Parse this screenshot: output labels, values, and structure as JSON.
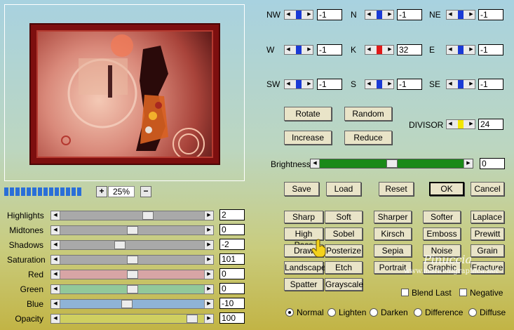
{
  "zoom": {
    "minus": "−",
    "plus": "+",
    "value": "25%"
  },
  "progress_segments": 14,
  "sliders": [
    {
      "label": "Highlights",
      "value": "2",
      "pos": 0.62,
      "color": "#a9a9a9"
    },
    {
      "label": "Midtones",
      "value": "0",
      "pos": 0.5,
      "color": "#a9a9a9"
    },
    {
      "label": "Shadows",
      "value": "-2",
      "pos": 0.41,
      "color": "#a9a9a9"
    },
    {
      "label": "Saturation",
      "value": "101",
      "pos": 0.5,
      "color": "#a9a9a9"
    },
    {
      "label": "Red",
      "value": "0",
      "pos": 0.5,
      "color": "#d8a5a5"
    },
    {
      "label": "Green",
      "value": "0",
      "pos": 0.5,
      "color": "#92c89a"
    },
    {
      "label": "Blue",
      "value": "-10",
      "pos": 0.46,
      "color": "#8fb3d6"
    },
    {
      "label": "Opacity",
      "value": "100",
      "pos": 0.95,
      "color": "#cfcf60"
    }
  ],
  "compass": [
    {
      "label": "NW",
      "value": "-1"
    },
    {
      "label": "N",
      "value": "-1"
    },
    {
      "label": "NE",
      "value": "-1"
    },
    {
      "label": "W",
      "value": "-1"
    },
    {
      "label": "K",
      "value": "32"
    },
    {
      "label": "E",
      "value": "-1"
    },
    {
      "label": "SW",
      "value": "-1"
    },
    {
      "label": "S",
      "value": "-1"
    },
    {
      "label": "SE",
      "value": "-1"
    }
  ],
  "buttons": {
    "rotate": "Rotate",
    "random": "Random",
    "increase": "Increase",
    "reduce": "Reduce"
  },
  "divisor": {
    "label": "DIVISOR",
    "value": "24"
  },
  "brightness": {
    "label": "Brightness",
    "value": "0",
    "pos": 0.5
  },
  "actions": {
    "save": "Save",
    "load": "Load",
    "reset": "Reset",
    "ok": "OK",
    "cancel": "Cancel"
  },
  "effects": [
    [
      "Sharp",
      "Soft",
      "Sharper",
      "Softer",
      "Laplace"
    ],
    [
      "High Pass",
      "Sobel",
      "Kirsch",
      "Emboss",
      "Prewitt"
    ],
    [
      "Draw",
      "Posterize",
      "Sepia",
      "Noise",
      "Grain"
    ],
    [
      "Landscape",
      "Etch",
      "Portrait",
      "Graphic",
      "Fracture"
    ],
    [
      "Spatter",
      "Grayscale"
    ]
  ],
  "checks": {
    "blend_last": "Blend Last",
    "negative": "Negative"
  },
  "modes": [
    "Normal",
    "Lighten",
    "Darken",
    "Difference",
    "Diffuse"
  ],
  "selected_mode": "Normal",
  "watermark": {
    "name": "Pinuccia",
    "url": "www.marifedigraphica.net"
  },
  "colors": {
    "track": "#a9a9a9",
    "thumb_blue": "#1a3ad6",
    "thumb_red": "#e01818",
    "thumb_yellow": "#f2e600",
    "brightness": "#1a8a18"
  }
}
